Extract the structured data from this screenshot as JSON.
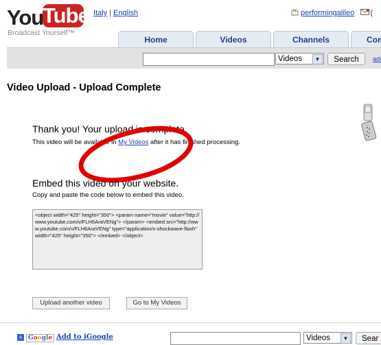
{
  "logo": {
    "you": "You",
    "tube": "Tube",
    "tagline": "Broadcast Yourself™"
  },
  "lang": {
    "country": "Italy",
    "language": "English"
  },
  "user": {
    "name": "performingalileo",
    "suffix": "("
  },
  "nav": {
    "tabs": [
      "Home",
      "Videos",
      "Channels",
      "Com"
    ]
  },
  "search": {
    "placeholder": "",
    "select_value": "Videos",
    "button": "Search",
    "advanced": "adv"
  },
  "page": {
    "title": "Video Upload - Upload Complete"
  },
  "message": {
    "thanks": "Thank you! Your upload is complete.",
    "avail_pre": "This video will be available in ",
    "avail_link": "My Videos",
    "avail_post": " after it has finished processing."
  },
  "embed": {
    "title": "Embed this video on your website.",
    "subtitle": "Copy and paste the code below to embed this video.",
    "code": "<object width=\"425\" height=\"350\"> <param name=\"movie\" value=\"http://www.youtube.com/v/FLH6AraVENg\"> </param> <embed src=\"http://www.youtube.com/v/FLH6AraVENg\" type=\"application/x-shockwave-flash\" width=\"425\" height=\"350\"> </embed> </object>"
  },
  "actions": {
    "upload_another": "Upload another video",
    "go_to": "Go to My Videos"
  },
  "footer": {
    "add_google": "Add to iGoogle",
    "select_value": "Videos",
    "button": "Sear",
    "badge_plus": "+"
  },
  "colors": {
    "youtube_red": "#cc2222",
    "link": "#1a3fb3",
    "annotation_red": "#e00000"
  },
  "icons": [
    "phone-icon",
    "tv-icon",
    "mail-icon",
    "google-plus-icon"
  ]
}
